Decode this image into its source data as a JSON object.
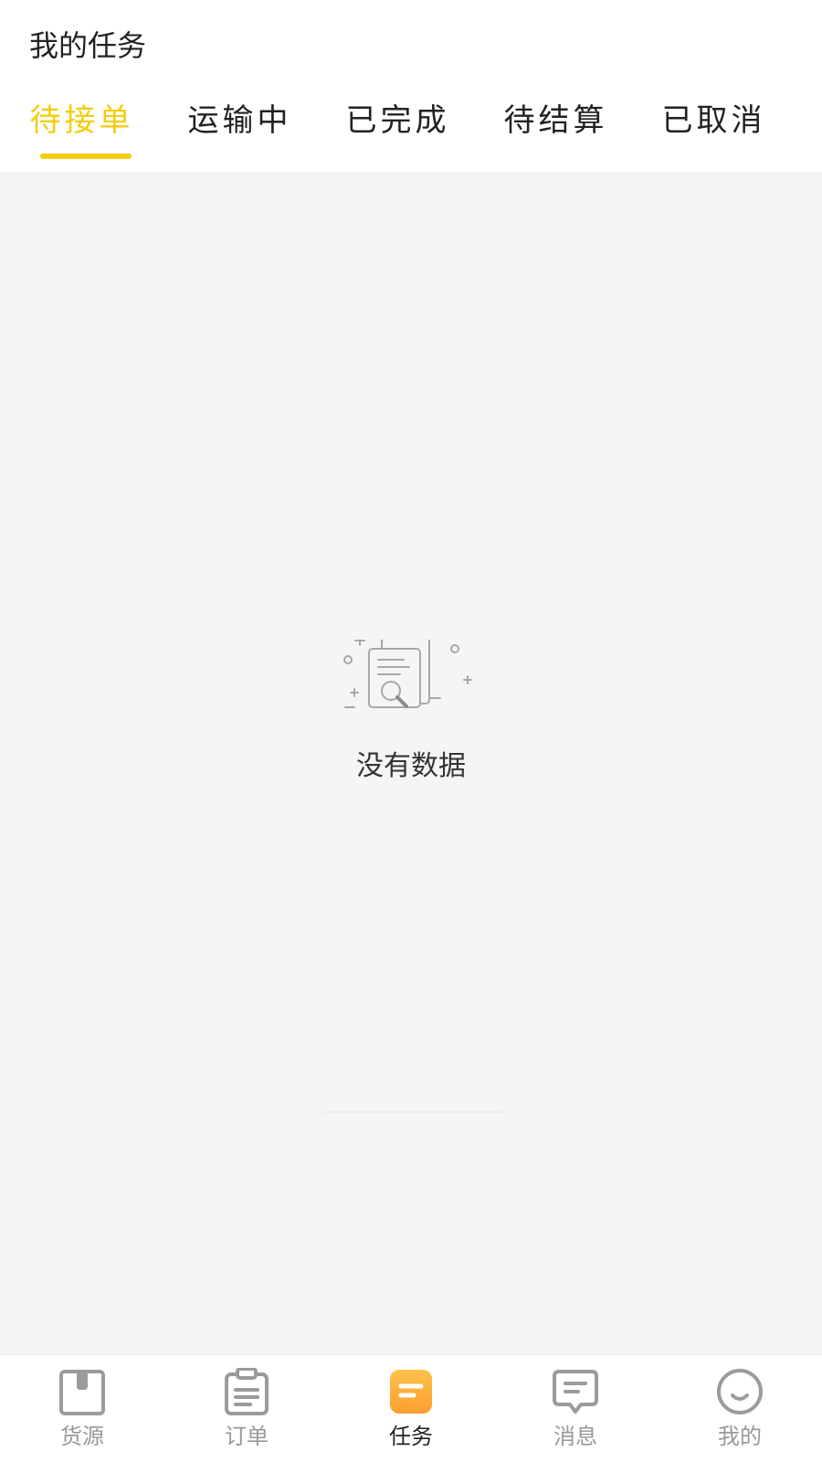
{
  "header": {
    "title": "我的任务"
  },
  "tabs": [
    {
      "label": "待接单",
      "active": true
    },
    {
      "label": "运输中",
      "active": false
    },
    {
      "label": "已完成",
      "active": false
    },
    {
      "label": "待结算",
      "active": false
    },
    {
      "label": "已取消",
      "active": false
    }
  ],
  "empty_state": {
    "icon": "document-search-icon",
    "text": "没有数据"
  },
  "tabbar": [
    {
      "label": "货源",
      "icon": "box-icon",
      "active": false
    },
    {
      "label": "订单",
      "icon": "clipboard-icon",
      "active": false
    },
    {
      "label": "任务",
      "icon": "task-icon",
      "active": true
    },
    {
      "label": "消息",
      "icon": "message-icon",
      "active": false
    },
    {
      "label": "我的",
      "icon": "smile-icon",
      "active": false
    }
  ],
  "colors": {
    "accent": "#f3cd0e",
    "active_icon": "#fbb03b",
    "inactive": "#999999",
    "text": "#222222",
    "background": "#f5f5f5"
  }
}
